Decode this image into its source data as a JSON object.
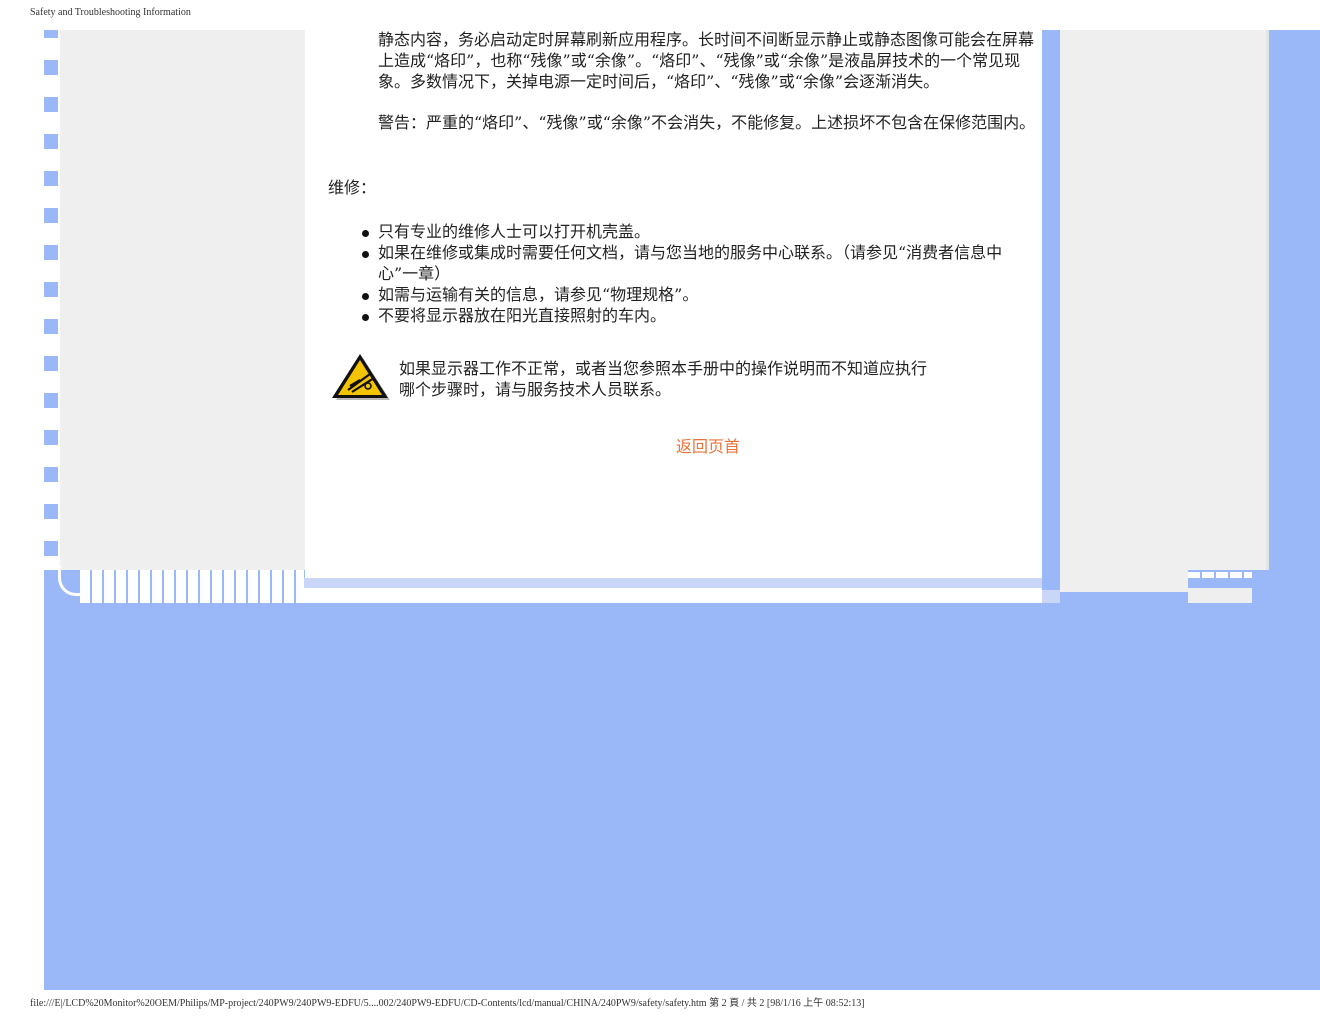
{
  "header": {
    "title": "Safety and Troubleshooting Information"
  },
  "content": {
    "para1": "静态内容，务必启动定时屏幕刷新应用程序。长时间不间断显示静止或静态图像可能会在屏幕上造成“烙印”，也称“残像”或“余像”。“烙印”、“残像”或“余像”是液晶屏技术的一个常见现象。多数情况下，关掉电源一定时间后，“烙印”、“残像”或“余像”会逐渐消失。",
    "para2": "警告：严重的“烙印”、“残像”或“余像”不会消失，不能修复。上述损坏不包含在保修范围内。",
    "section_label": "维修：",
    "bullets": [
      "只有专业的维修人士可以打开机壳盖。",
      "如果在维修或集成时需要任何文档，请与您当地的服务中心联系。（请参见“消费者信息中心”一章）",
      "如需与运输有关的信息，请参见“物理规格”。",
      "不要将显示器放在阳光直接照射的车内。"
    ],
    "warning_icon": "warning-triangle-icon",
    "warning_line1": "如果显示器工作不正常，或者当您参照本手册中的操作说明而不知道应执行",
    "warning_line2": "哪个步骤时，请与服务技术人员联系。",
    "back_link": "返回页首",
    "link_color": "#e8743a"
  },
  "footer": {
    "path": "file:///E|/LCD%20Monitor%20OEM/Philips/MP-project/240PW9/240PW9-EDFU/5....002/240PW9-EDFU/CD-Contents/lcd/manual/CHINA/240PW9/safety/safety.htm 第 2 頁 / 共 2 [98/1/16 上午 08:52:13]"
  },
  "colors": {
    "frame": "#9ab8f8",
    "panel": "#efefef"
  }
}
